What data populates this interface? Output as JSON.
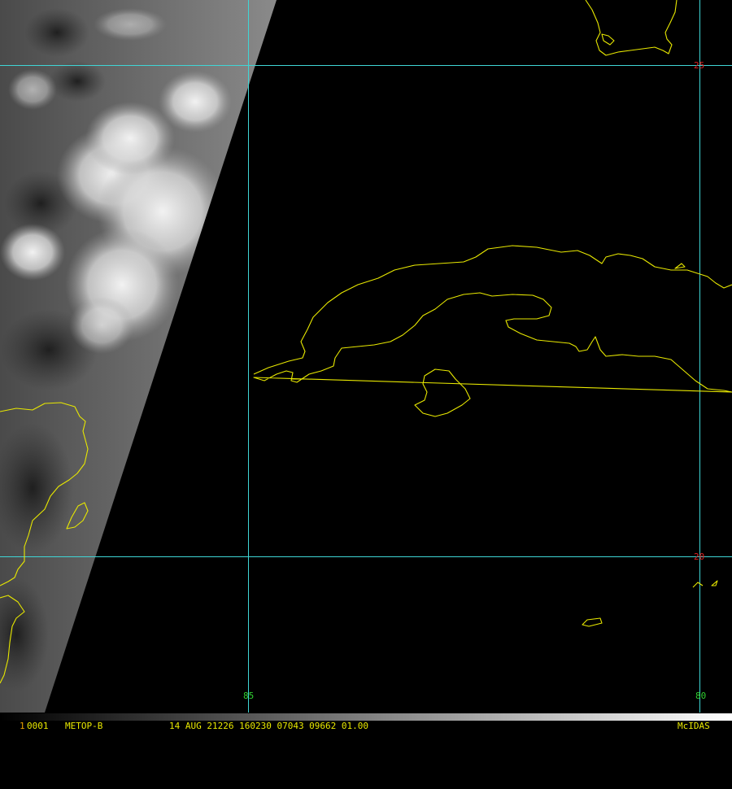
{
  "grid_labels": {
    "lat_25": "25",
    "lat_20": "20",
    "lon_85": "85",
    "lon_80": "80"
  },
  "status_bar": {
    "frame_number": "1",
    "image_id": "0001",
    "satellite": "METOP-B",
    "timestamp_info": "14 AUG 21226 160230 07043 09662 01.00",
    "software": "McIDAS"
  },
  "colors": {
    "background": "#000000",
    "grid_lines": "#3fd6d6",
    "coastline": "#e8e800",
    "lat_label": "#e02020",
    "lon_label": "#30d030",
    "status_text": "#e8e800",
    "status_frame": "#e8a000"
  }
}
